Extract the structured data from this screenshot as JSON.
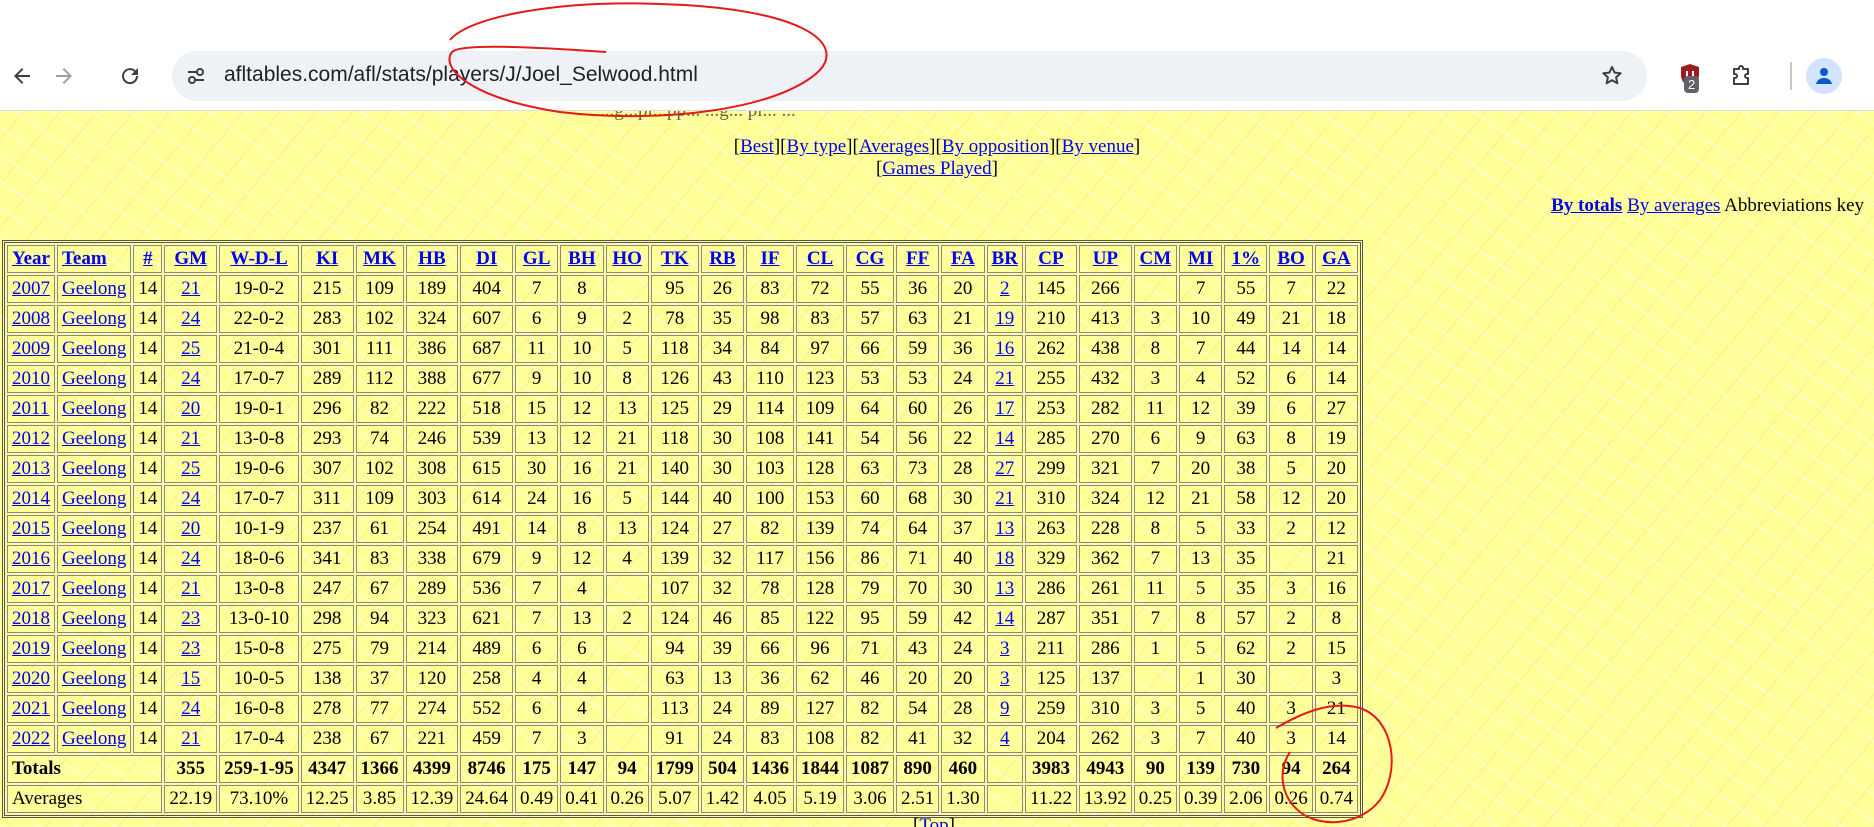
{
  "browser": {
    "url": "afltables.com/afl/stats/players/J/Joel_Selwood.html",
    "extension_badge": "2"
  },
  "page": {
    "cut_line": "...g...pl...pp... ...g... pl... ...",
    "nav_links": [
      "Best",
      "By type",
      "Averages",
      "By opposition",
      "By venue"
    ],
    "games_played": "Games Played",
    "view_toggle": {
      "totals": "By totals",
      "averages": "By averages",
      "key": "Abbreviations key"
    },
    "top_link": "Top"
  },
  "table": {
    "headers": [
      "Year",
      "Team",
      "#",
      "GM",
      "W-D-L",
      "KI",
      "MK",
      "HB",
      "DI",
      "GL",
      "BH",
      "HO",
      "TK",
      "RB",
      "IF",
      "CL",
      "CG",
      "FF",
      "FA",
      "BR",
      "CP",
      "UP",
      "CM",
      "MI",
      "1%",
      "BO",
      "GA"
    ],
    "rows": [
      [
        "2007",
        "Geelong",
        "14",
        "21",
        "19-0-2",
        "215",
        "109",
        "189",
        "404",
        "7",
        "8",
        "",
        "95",
        "26",
        "83",
        "72",
        "55",
        "36",
        "20",
        "2",
        "145",
        "266",
        "",
        "7",
        "55",
        "7",
        "22"
      ],
      [
        "2008",
        "Geelong",
        "14",
        "24",
        "22-0-2",
        "283",
        "102",
        "324",
        "607",
        "6",
        "9",
        "2",
        "78",
        "35",
        "98",
        "83",
        "57",
        "63",
        "21",
        "19",
        "210",
        "413",
        "3",
        "10",
        "49",
        "21",
        "18"
      ],
      [
        "2009",
        "Geelong",
        "14",
        "25",
        "21-0-4",
        "301",
        "111",
        "386",
        "687",
        "11",
        "10",
        "5",
        "118",
        "34",
        "84",
        "97",
        "66",
        "59",
        "36",
        "16",
        "262",
        "438",
        "8",
        "7",
        "44",
        "14",
        "14"
      ],
      [
        "2010",
        "Geelong",
        "14",
        "24",
        "17-0-7",
        "289",
        "112",
        "388",
        "677",
        "9",
        "10",
        "8",
        "126",
        "43",
        "110",
        "123",
        "53",
        "53",
        "24",
        "21",
        "255",
        "432",
        "3",
        "4",
        "52",
        "6",
        "14"
      ],
      [
        "2011",
        "Geelong",
        "14",
        "20",
        "19-0-1",
        "296",
        "82",
        "222",
        "518",
        "15",
        "12",
        "13",
        "125",
        "29",
        "114",
        "109",
        "64",
        "60",
        "26",
        "17",
        "253",
        "282",
        "11",
        "12",
        "39",
        "6",
        "27"
      ],
      [
        "2012",
        "Geelong",
        "14",
        "21",
        "13-0-8",
        "293",
        "74",
        "246",
        "539",
        "13",
        "12",
        "21",
        "118",
        "30",
        "108",
        "141",
        "54",
        "56",
        "22",
        "14",
        "285",
        "270",
        "6",
        "9",
        "63",
        "8",
        "19"
      ],
      [
        "2013",
        "Geelong",
        "14",
        "25",
        "19-0-6",
        "307",
        "102",
        "308",
        "615",
        "30",
        "16",
        "21",
        "140",
        "30",
        "103",
        "128",
        "63",
        "73",
        "28",
        "27",
        "299",
        "321",
        "7",
        "20",
        "38",
        "5",
        "20"
      ],
      [
        "2014",
        "Geelong",
        "14",
        "24",
        "17-0-7",
        "311",
        "109",
        "303",
        "614",
        "24",
        "16",
        "5",
        "144",
        "40",
        "100",
        "153",
        "60",
        "68",
        "30",
        "21",
        "310",
        "324",
        "12",
        "21",
        "58",
        "12",
        "20"
      ],
      [
        "2015",
        "Geelong",
        "14",
        "20",
        "10-1-9",
        "237",
        "61",
        "254",
        "491",
        "14",
        "8",
        "13",
        "124",
        "27",
        "82",
        "139",
        "74",
        "64",
        "37",
        "13",
        "263",
        "228",
        "8",
        "5",
        "33",
        "2",
        "12"
      ],
      [
        "2016",
        "Geelong",
        "14",
        "24",
        "18-0-6",
        "341",
        "83",
        "338",
        "679",
        "9",
        "12",
        "4",
        "139",
        "32",
        "117",
        "156",
        "86",
        "71",
        "40",
        "18",
        "329",
        "362",
        "7",
        "13",
        "35",
        "",
        "21"
      ],
      [
        "2017",
        "Geelong",
        "14",
        "21",
        "13-0-8",
        "247",
        "67",
        "289",
        "536",
        "7",
        "4",
        "",
        "107",
        "32",
        "78",
        "128",
        "79",
        "70",
        "30",
        "13",
        "286",
        "261",
        "11",
        "5",
        "35",
        "3",
        "16"
      ],
      [
        "2018",
        "Geelong",
        "14",
        "23",
        "13-0-10",
        "298",
        "94",
        "323",
        "621",
        "7",
        "13",
        "2",
        "124",
        "46",
        "85",
        "122",
        "95",
        "59",
        "42",
        "14",
        "287",
        "351",
        "7",
        "8",
        "57",
        "2",
        "8"
      ],
      [
        "2019",
        "Geelong",
        "14",
        "23",
        "15-0-8",
        "275",
        "79",
        "214",
        "489",
        "6",
        "6",
        "",
        "94",
        "39",
        "66",
        "96",
        "71",
        "43",
        "24",
        "3",
        "211",
        "286",
        "1",
        "5",
        "62",
        "2",
        "15"
      ],
      [
        "2020",
        "Geelong",
        "14",
        "15",
        "10-0-5",
        "138",
        "37",
        "120",
        "258",
        "4",
        "4",
        "",
        "63",
        "13",
        "36",
        "62",
        "46",
        "20",
        "20",
        "3",
        "125",
        "137",
        "",
        "1",
        "30",
        "",
        "3"
      ],
      [
        "2021",
        "Geelong",
        "14",
        "24",
        "16-0-8",
        "278",
        "77",
        "274",
        "552",
        "6",
        "4",
        "",
        "113",
        "24",
        "89",
        "127",
        "82",
        "54",
        "28",
        "9",
        "259",
        "310",
        "3",
        "5",
        "40",
        "3",
        "21"
      ],
      [
        "2022",
        "Geelong",
        "14",
        "21",
        "17-0-4",
        "238",
        "67",
        "221",
        "459",
        "7",
        "3",
        "",
        "91",
        "24",
        "83",
        "108",
        "82",
        "41",
        "32",
        "4",
        "204",
        "262",
        "3",
        "7",
        "40",
        "3",
        "14"
      ]
    ],
    "totals": [
      "Totals",
      "",
      "",
      "355",
      "259-1-95",
      "4347",
      "1366",
      "4399",
      "8746",
      "175",
      "147",
      "94",
      "1799",
      "504",
      "1436",
      "1844",
      "1087",
      "890",
      "460",
      "",
      "3983",
      "4943",
      "90",
      "139",
      "730",
      "94",
      "264"
    ],
    "averages": [
      "Averages",
      "",
      "",
      "22.19",
      "73.10%",
      "12.25",
      "3.85",
      "12.39",
      "24.64",
      "0.49",
      "0.41",
      "0.26",
      "5.07",
      "1.42",
      "4.05",
      "5.19",
      "3.06",
      "2.51",
      "1.30",
      "",
      "11.22",
      "13.92",
      "0.25",
      "0.39",
      "2.06",
      "0.26",
      "0.74"
    ]
  },
  "colors": {
    "annotation": "#e31b1b",
    "page_bg": "#ffff99",
    "link": "#0000ee"
  }
}
